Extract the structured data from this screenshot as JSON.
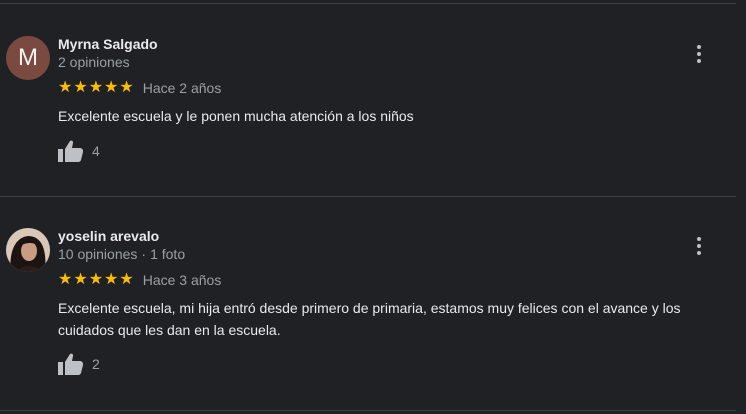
{
  "reviews": [
    {
      "author": "Myrna Salgado",
      "avatar_letter": "M",
      "avatar_color": "#7a4a41",
      "meta": "2 opiniones",
      "meta_extra": "",
      "stars": "★★★★★",
      "rating": 5,
      "date": "Hace 2 años",
      "text": "Excelente escuela y le ponen mucha atención a los niños",
      "likes": "4"
    },
    {
      "author": "yoselin arevalo",
      "avatar_letter": "",
      "meta": "10 opiniones",
      "meta_sep": "·",
      "meta_extra": "1 foto",
      "stars": "★★★★★",
      "rating": 5,
      "date": "Hace 3 años",
      "text": "Excelente escuela, mi hija entró desde primero de primaria, estamos muy felices con el avance y los cuidados que les dan en la escuela.",
      "likes": "2"
    }
  ],
  "colors": {
    "background": "#202124",
    "star": "#fbbc04",
    "divider": "#3c4043"
  },
  "icons": {
    "like": "thumbs-up-icon",
    "menu": "more-vert-icon"
  }
}
